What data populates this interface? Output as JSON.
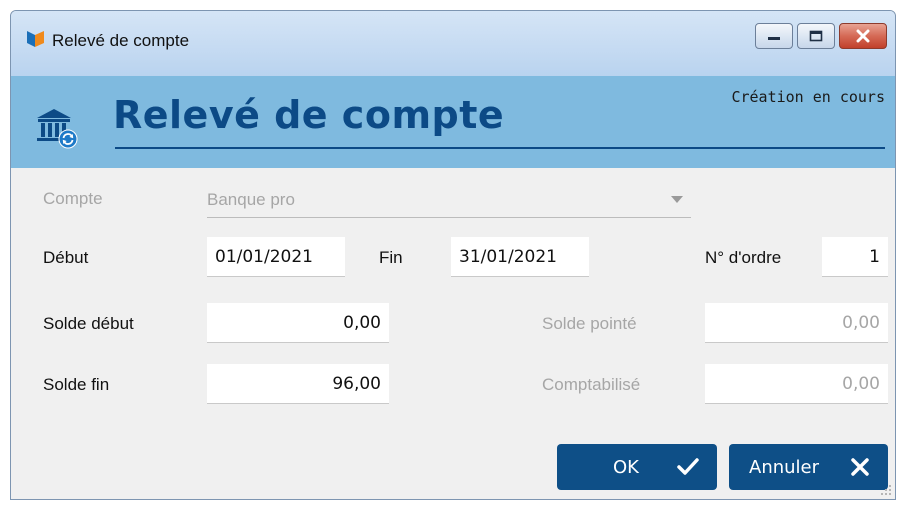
{
  "window": {
    "title": "Relevé de compte"
  },
  "header": {
    "title": "Relevé de compte",
    "status": "Création en cours"
  },
  "form": {
    "compte": {
      "label": "Compte",
      "value": "Banque pro"
    },
    "debut": {
      "label": "Début",
      "value": "01/01/2021"
    },
    "fin": {
      "label": "Fin",
      "value": "31/01/2021"
    },
    "ordre": {
      "label": "N° d'ordre",
      "value": "1"
    },
    "solde_debut": {
      "label": "Solde début",
      "value": "0,00"
    },
    "solde_pointe": {
      "label": "Solde pointé",
      "value": "0,00"
    },
    "solde_fin": {
      "label": "Solde fin",
      "value": "96,00"
    },
    "comptabilise": {
      "label": "Comptabilisé",
      "value": "0,00"
    }
  },
  "buttons": {
    "ok_label": "OK",
    "cancel_label": "Annuler"
  },
  "icons": {
    "app": "app-logo-icon",
    "bank": "bank-icon",
    "minimize": "minimize-icon",
    "maximize": "maximize-icon",
    "close": "close-icon",
    "check": "check-icon",
    "cancel": "x-icon",
    "dropdown": "chevron-down-icon",
    "grip": "resize-grip-icon"
  },
  "colors": {
    "accent": "#0e4f87",
    "header_band": "#7fbadf",
    "disabled_text": "#a6a6a6"
  }
}
